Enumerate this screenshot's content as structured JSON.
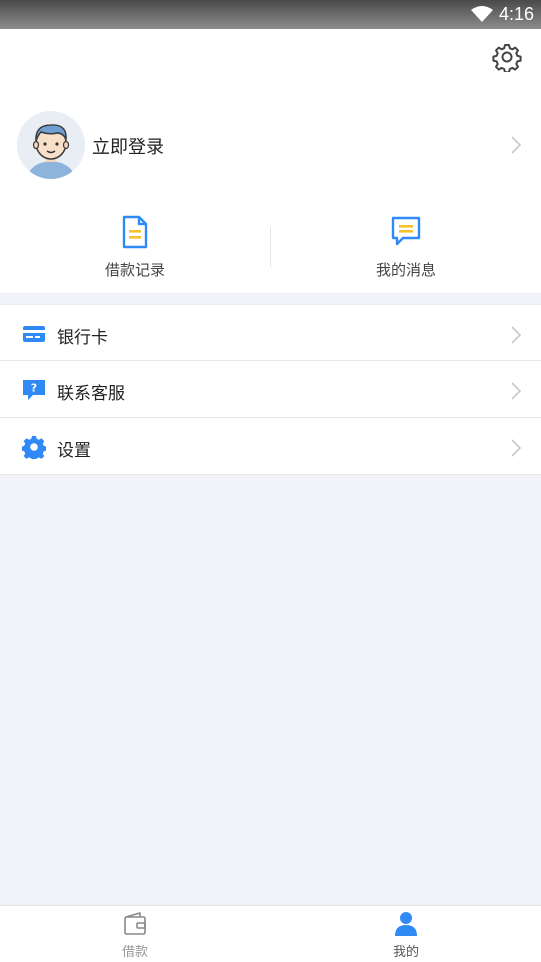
{
  "status_bar": {
    "time": "4:16"
  },
  "profile": {
    "login_label": "立即登录"
  },
  "quick_actions": [
    {
      "label": "借款记录",
      "icon": "document-icon"
    },
    {
      "label": "我的消息",
      "icon": "message-icon"
    }
  ],
  "menu": [
    {
      "label": "银行卡",
      "icon": "bank-card-icon"
    },
    {
      "label": "联系客服",
      "icon": "customer-service-icon"
    },
    {
      "label": "设置",
      "icon": "settings-icon"
    }
  ],
  "bottom_nav": [
    {
      "label": "借款",
      "icon": "wallet-icon",
      "active": false
    },
    {
      "label": "我的",
      "icon": "user-icon",
      "active": true
    }
  ],
  "colors": {
    "accent": "#2f8af5",
    "yellow": "#f7c12b",
    "inactive": "#999999",
    "background": "#f1f3f8"
  }
}
